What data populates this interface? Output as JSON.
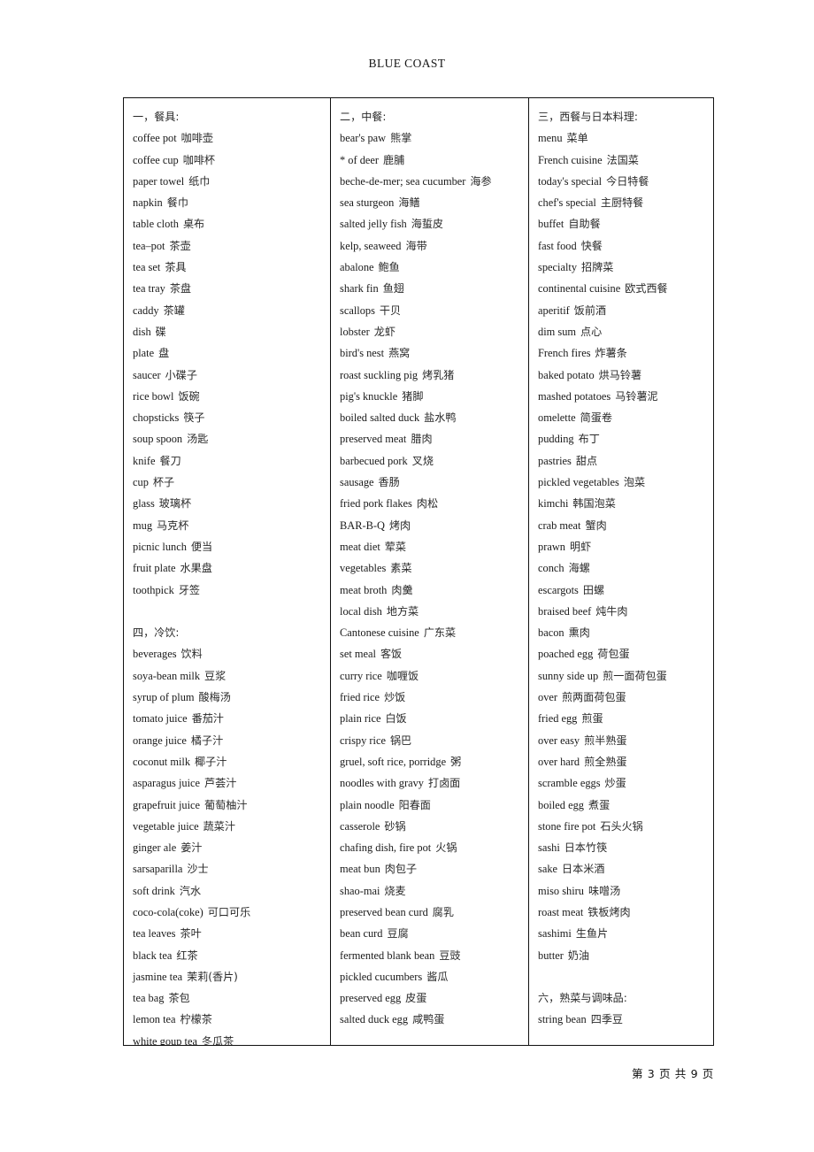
{
  "header": {
    "title": "BLUE COAST"
  },
  "footer": {
    "page_label": "第 3 页 共 9 页"
  },
  "table": {
    "columns": [
      {
        "id": "column-1",
        "blocks": [
          {
            "type": "section",
            "heading": "一，餐具:",
            "entries": [
              {
                "en": "coffee pot",
                "zh": "咖啡壶"
              },
              {
                "en": "coffee cup",
                "zh": "咖啡杯"
              },
              {
                "en": "paper towel",
                "zh": "纸巾"
              },
              {
                "en": "napkin",
                "zh": "餐巾"
              },
              {
                "en": "table cloth",
                "zh": "桌布"
              },
              {
                "en": "tea–pot",
                "zh": "茶壶"
              },
              {
                "en": "tea set",
                "zh": "茶具"
              },
              {
                "en": "tea tray",
                "zh": "茶盘"
              },
              {
                "en": "caddy",
                "zh": "茶罐"
              },
              {
                "en": "dish",
                "zh": "碟"
              },
              {
                "en": "plate",
                "zh": "盘"
              },
              {
                "en": "saucer",
                "zh": "小碟子"
              },
              {
                "en": "rice bowl",
                "zh": "饭碗"
              },
              {
                "en": "chopsticks",
                "zh": "筷子"
              },
              {
                "en": "soup spoon",
                "zh": "汤匙"
              },
              {
                "en": "knife",
                "zh": "餐刀"
              },
              {
                "en": "cup",
                "zh": "杯子"
              },
              {
                "en": "glass",
                "zh": "玻璃杯"
              },
              {
                "en": "mug",
                "zh": "马克杯"
              },
              {
                "en": "picnic lunch",
                "zh": "便当"
              },
              {
                "en": "fruit plate",
                "zh": "水果盘"
              },
              {
                "en": "toothpick",
                "zh": "牙签"
              }
            ]
          },
          {
            "type": "section",
            "spacer_before": true,
            "heading": "四，冷饮:",
            "entries": [
              {
                "en": "beverages",
                "zh": "饮料"
              },
              {
                "en": "soya-bean milk",
                "zh": "豆浆"
              },
              {
                "en": "syrup of plum",
                "zh": "酸梅汤"
              },
              {
                "en": "tomato juice",
                "zh": "番茄汁"
              },
              {
                "en": "orange juice",
                "zh": "橘子汁"
              },
              {
                "en": "coconut milk",
                "zh": "椰子汁"
              },
              {
                "en": "asparagus juice",
                "zh": "芦荟汁"
              },
              {
                "en": "grapefruit juice",
                "zh": "葡萄柚汁"
              },
              {
                "en": "vegetable juice",
                "zh": "蔬菜汁"
              },
              {
                "en": "ginger ale",
                "zh": "姜汁"
              },
              {
                "en": "sarsaparilla",
                "zh": "沙士"
              },
              {
                "en": "soft drink",
                "zh": "汽水"
              },
              {
                "en": "coco-cola(coke)",
                "zh": "可口可乐"
              },
              {
                "en": "tea leaves",
                "zh": "茶叶"
              },
              {
                "en": "black tea",
                "zh": "红茶"
              },
              {
                "en": "jasmine tea",
                "zh": "茉莉(香片)"
              },
              {
                "en": "tea bag",
                "zh": "茶包"
              },
              {
                "en": "lemon tea",
                "zh": "柠檬茶"
              },
              {
                "en": "white goup tea",
                "zh": "冬瓜茶"
              }
            ]
          }
        ]
      },
      {
        "id": "column-2",
        "blocks": [
          {
            "type": "section",
            "heading": "二，中餐:",
            "entries": [
              {
                "en": "bear's paw",
                "zh": "熊掌"
              },
              {
                "en": "* of deer",
                "zh": "鹿脯"
              },
              {
                "en": "beche-de-mer; sea cucumber",
                "zh": "海参"
              },
              {
                "en": "sea sturgeon",
                "zh": "海鳝"
              },
              {
                "en": "salted jelly fish",
                "zh": "海蜇皮"
              },
              {
                "en": "kelp, seaweed",
                "zh": "海带"
              },
              {
                "en": "abalone",
                "zh": "鲍鱼"
              },
              {
                "en": "shark fin",
                "zh": "鱼翅"
              },
              {
                "en": "scallops",
                "zh": "干贝"
              },
              {
                "en": "lobster",
                "zh": "龙虾"
              },
              {
                "en": "bird's nest",
                "zh": "燕窝"
              },
              {
                "en": "roast suckling pig",
                "zh": "烤乳猪"
              },
              {
                "en": "pig's knuckle",
                "zh": "猪脚"
              },
              {
                "en": "boiled salted duck",
                "zh": "盐水鸭"
              },
              {
                "en": "preserved meat",
                "zh": "腊肉"
              },
              {
                "en": "barbecued pork",
                "zh": "叉烧"
              },
              {
                "en": "sausage",
                "zh": "香肠"
              },
              {
                "en": "fried pork flakes",
                "zh": "肉松"
              },
              {
                "en": "BAR-B-Q",
                "zh": "烤肉"
              },
              {
                "en": "meat diet",
                "zh": "荤菜"
              },
              {
                "en": "vegetables",
                "zh": "素菜"
              },
              {
                "en": "meat broth",
                "zh": "肉羹"
              },
              {
                "en": "local dish",
                "zh": "地方菜"
              },
              {
                "en": "Cantonese cuisine",
                "zh": "广东菜"
              },
              {
                "en": "set meal",
                "zh": "客饭"
              },
              {
                "en": "curry rice",
                "zh": "咖喱饭"
              },
              {
                "en": "fried rice",
                "zh": "炒饭"
              },
              {
                "en": "plain rice",
                "zh": "白饭"
              },
              {
                "en": "crispy rice",
                "zh": "锅巴"
              },
              {
                "en": "gruel, soft rice, porridge",
                "zh": "粥"
              },
              {
                "en": "noodles with gravy",
                "zh": "打卤面"
              },
              {
                "en": "plain noodle",
                "zh": "阳春面"
              },
              {
                "en": "casserole",
                "zh": "砂锅"
              },
              {
                "en": "chafing dish, fire pot",
                "zh": "火锅"
              },
              {
                "en": "meat bun",
                "zh": "肉包子"
              },
              {
                "en": "shao-mai",
                "zh": "烧麦"
              },
              {
                "en": "preserved bean curd",
                "zh": "腐乳"
              },
              {
                "en": "bean curd",
                "zh": "豆腐"
              },
              {
                "en": "fermented blank bean",
                "zh": "豆豉"
              },
              {
                "en": "pickled cucumbers",
                "zh": "酱瓜"
              },
              {
                "en": "preserved egg",
                "zh": "皮蛋"
              },
              {
                "en": "salted duck egg",
                "zh": "咸鸭蛋"
              }
            ]
          }
        ]
      },
      {
        "id": "column-3",
        "blocks": [
          {
            "type": "section",
            "heading": "三，西餐与日本料理:",
            "entries": [
              {
                "en": "menu",
                "zh": "菜单"
              },
              {
                "en": "French cuisine",
                "zh": "法国菜"
              },
              {
                "en": "today's special",
                "zh": "今日特餐"
              },
              {
                "en": "chef's special",
                "zh": "主厨特餐"
              },
              {
                "en": "buffet",
                "zh": "自助餐"
              },
              {
                "en": "fast food",
                "zh": "快餐"
              },
              {
                "en": "specialty",
                "zh": "招牌菜"
              },
              {
                "en": "continental cuisine",
                "zh": "欧式西餐"
              },
              {
                "en": "aperitif",
                "zh": "饭前酒"
              },
              {
                "en": "dim sum",
                "zh": "点心"
              },
              {
                "en": "French fires",
                "zh": "炸薯条"
              },
              {
                "en": "baked potato",
                "zh": "烘马铃薯"
              },
              {
                "en": "mashed potatoes",
                "zh": "马铃薯泥"
              },
              {
                "en": "omelette",
                "zh": "简蛋卷"
              },
              {
                "en": "pudding",
                "zh": "布丁"
              },
              {
                "en": "pastries",
                "zh": "甜点"
              },
              {
                "en": "pickled vegetables",
                "zh": "泡菜"
              },
              {
                "en": "kimchi",
                "zh": "韩国泡菜"
              },
              {
                "en": "crab meat",
                "zh": "蟹肉"
              },
              {
                "en": "prawn",
                "zh": "明虾"
              },
              {
                "en": "conch",
                "zh": "海螺"
              },
              {
                "en": "escargots",
                "zh": "田螺"
              },
              {
                "en": "braised beef",
                "zh": "炖牛肉"
              },
              {
                "en": "bacon",
                "zh": "熏肉"
              },
              {
                "en": "poached egg",
                "zh": "荷包蛋"
              },
              {
                "en": "sunny side up",
                "zh": "煎一面荷包蛋"
              },
              {
                "en": "over",
                "zh": "煎两面荷包蛋"
              },
              {
                "en": "fried egg",
                "zh": "煎蛋"
              },
              {
                "en": "over easy",
                "zh": "煎半熟蛋"
              },
              {
                "en": "over hard",
                "zh": "煎全熟蛋"
              },
              {
                "en": "scramble eggs",
                "zh": "炒蛋"
              },
              {
                "en": "boiled egg",
                "zh": "煮蛋"
              },
              {
                "en": "stone fire pot",
                "zh": "石头火锅"
              },
              {
                "en": "sashi",
                "zh": "日本竹筷"
              },
              {
                "en": "sake",
                "zh": "日本米酒"
              },
              {
                "en": "miso shiru",
                "zh": "味噌汤"
              },
              {
                "en": "roast meat",
                "zh": "铁板烤肉"
              },
              {
                "en": "sashimi",
                "zh": "生鱼片"
              },
              {
                "en": "butter",
                "zh": "奶油"
              }
            ]
          },
          {
            "type": "section",
            "spacer_before": true,
            "heading": "六，熟菜与调味品:",
            "entries": [
              {
                "en": "string bean",
                "zh": "四季豆"
              }
            ]
          }
        ]
      }
    ]
  }
}
